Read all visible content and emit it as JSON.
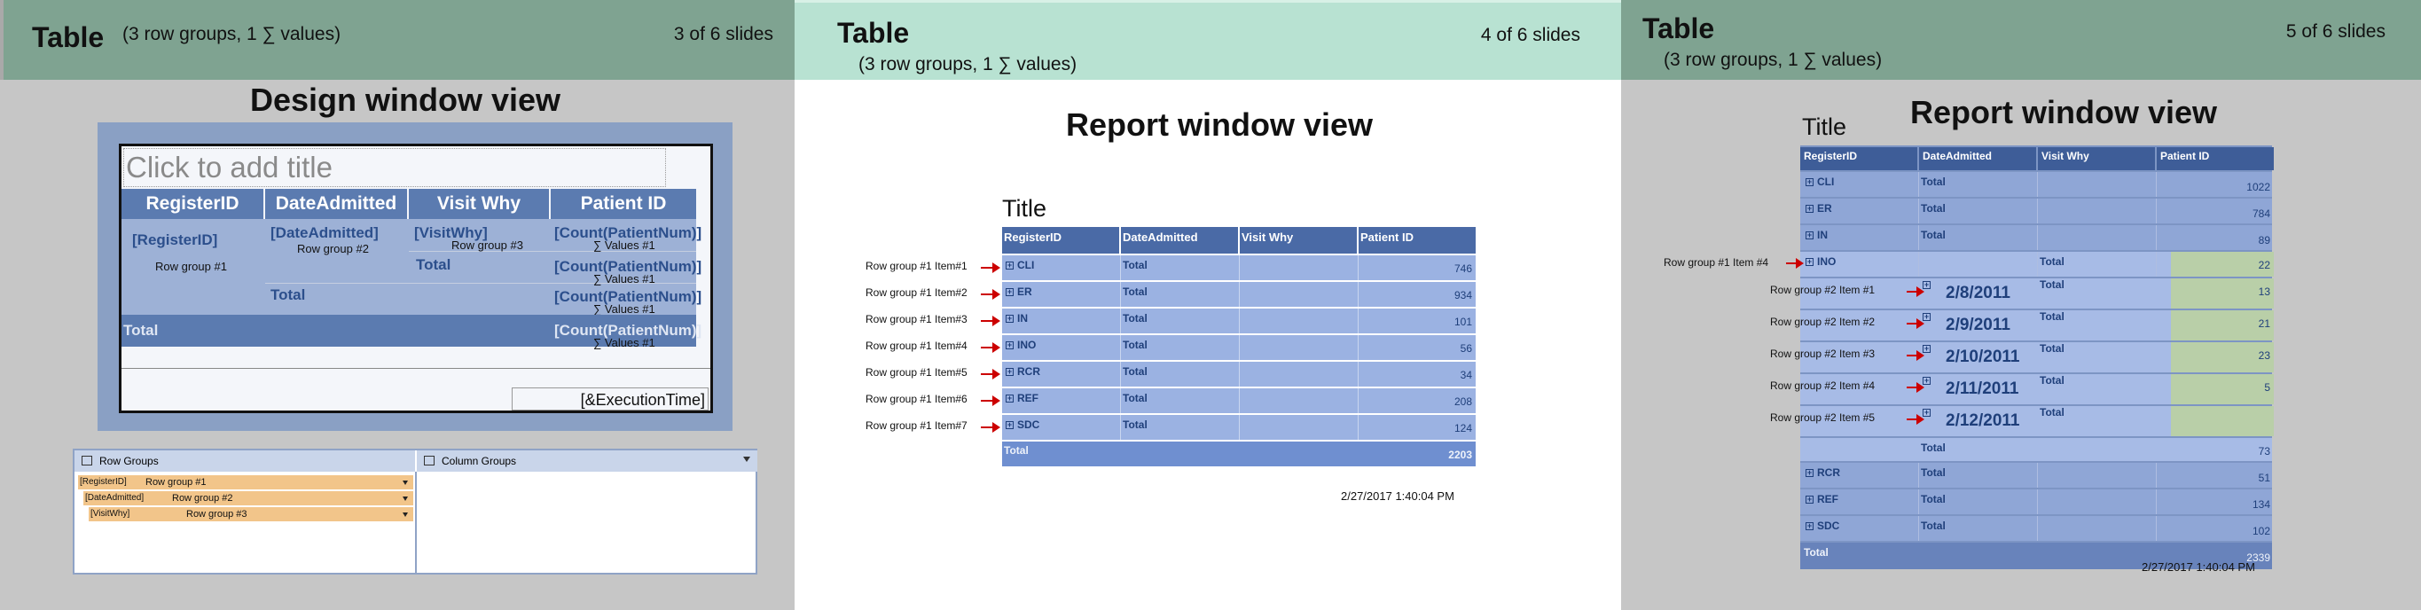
{
  "slides": [
    {
      "title": "Table",
      "subtitle": "(3 row groups, 1 ∑ values)",
      "counter": "3 of 6 slides",
      "heading": "Design window view",
      "design": {
        "title_placeholder": "Click to add title",
        "columns": [
          "RegisterID",
          "DateAdmitted",
          "Visit Why",
          "Patient ID"
        ],
        "reg_field": "[RegisterID]",
        "reg_group": "Row group #1",
        "date_field": "[DateAdmitted]",
        "date_group": "Row group #2",
        "visit_field": "[VisitWhy]",
        "visit_group": "Row group #3",
        "count_field": "[Count(PatientNum)]",
        "values_label": "∑ Values #1",
        "total_label": "Total",
        "execution_time": "[&ExecutionTime]"
      },
      "groups_panel": {
        "row_groups_label": "Row Groups",
        "column_groups_label": "Column Groups",
        "items": [
          {
            "field": "[RegisterID]",
            "name": "Row group #1"
          },
          {
            "field": "[DateAdmitted]",
            "name": "Row group #2"
          },
          {
            "field": "[VisitWhy]",
            "name": "Row group #3"
          }
        ]
      }
    },
    {
      "title": "Table",
      "subtitle": "(3 row groups, 1 ∑ values)",
      "counter": "4 of 6 slides",
      "heading": "Report window view",
      "report_title": "Title",
      "columns": [
        "RegisterID",
        "DateAdmitted",
        "Visit Why",
        "Patient ID"
      ],
      "rows": [
        {
          "label": "Row group #1 Item#1",
          "reg": "CLI",
          "total": "Total",
          "value": "746"
        },
        {
          "label": "Row group #1 Item#2",
          "reg": "ER",
          "total": "Total",
          "value": "934"
        },
        {
          "label": "Row group #1 Item#3",
          "reg": "IN",
          "total": "Total",
          "value": "101"
        },
        {
          "label": "Row group #1 Item#4",
          "reg": "INO",
          "total": "Total",
          "value": "56"
        },
        {
          "label": "Row group #1 Item#5",
          "reg": "RCR",
          "total": "Total",
          "value": "34"
        },
        {
          "label": "Row group #1 Item#6",
          "reg": "REF",
          "total": "Total",
          "value": "208"
        },
        {
          "label": "Row group #1 Item#7",
          "reg": "SDC",
          "total": "Total",
          "value": "124"
        }
      ],
      "grand_total_label": "Total",
      "grand_total": "2203",
      "timestamp": "2/27/2017  1:40:04 PM"
    },
    {
      "title": "Table",
      "subtitle": "(3 row groups, 1 ∑ values)",
      "counter": "5 of 6 slides",
      "heading": "Report window view",
      "report_title": "Title",
      "columns": [
        "RegisterID",
        "DateAdmitted",
        "Visit Why",
        "Patient ID"
      ],
      "top_rows": [
        {
          "reg": "CLI",
          "total": "Total",
          "value": "1022"
        },
        {
          "reg": "ER",
          "total": "Total",
          "value": "784"
        },
        {
          "reg": "IN",
          "total": "Total",
          "value": "89"
        }
      ],
      "ino_row": {
        "label": "Row group #1 Item #4",
        "reg": "INO",
        "total": "Total",
        "value": "22"
      },
      "date_rows": [
        {
          "label": "Row group #2 Item #1",
          "date": "2/8/2011",
          "total": "Total",
          "value": "13"
        },
        {
          "label": "Row group #2 Item #2",
          "date": "2/9/2011",
          "total": "Total",
          "value": "21"
        },
        {
          "label": "Row group #2 Item #3",
          "date": "2/10/2011",
          "total": "Total",
          "value": "23"
        },
        {
          "label": "Row group #2 Item #4",
          "date": "2/11/2011",
          "total": "Total",
          "value": "5"
        },
        {
          "label": "Row group #2 Item #5",
          "date": "2/12/2011",
          "total": "Total",
          "value": ""
        }
      ],
      "ino_total": {
        "label": "Total",
        "value": "73"
      },
      "bottom_rows": [
        {
          "reg": "RCR",
          "total": "Total",
          "value": "51"
        },
        {
          "reg": "REF",
          "total": "Total",
          "value": "134"
        },
        {
          "reg": "SDC",
          "total": "Total",
          "value": "102"
        }
      ],
      "grand_total_label": "Total",
      "grand_total": "2339",
      "timestamp": "2/27/2017  1:40:04 PM"
    }
  ]
}
